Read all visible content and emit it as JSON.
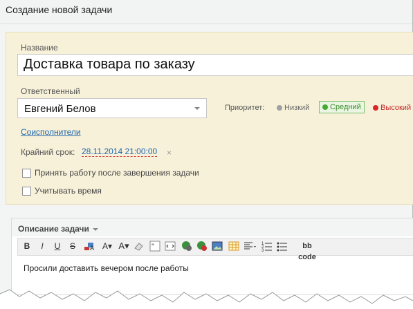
{
  "window": {
    "title": "Создание новой задачи"
  },
  "form": {
    "name_label": "Название",
    "name_value": "Доставка товара по заказу",
    "responsible_label": "Ответственный",
    "responsible_value": "Евгений Белов",
    "priority_label": "Приоритет:",
    "priority_options": [
      "Низкий",
      "Средний",
      "Высокий"
    ],
    "priority_selected": "Средний",
    "priority_colors": {
      "low": "#a0a0a0",
      "medium": "#47a833",
      "high": "#d9262c"
    },
    "co_executors_link": "Соисполнители",
    "deadline_label": "Крайний срок:",
    "deadline_value": "28.11.2014 21:00:00",
    "deadline_clear": "×",
    "checkbox_accept": "Принять работу после завершения задачи",
    "checkbox_time": "Учитывать время"
  },
  "editor": {
    "section_title": "Описание задачи",
    "toolbar": {
      "bold": "B",
      "italic": "I",
      "underline": "U",
      "strike": "S",
      "font_size": "A",
      "bbcode": "bb code"
    },
    "content": "Просили доставить вечером после работы"
  }
}
